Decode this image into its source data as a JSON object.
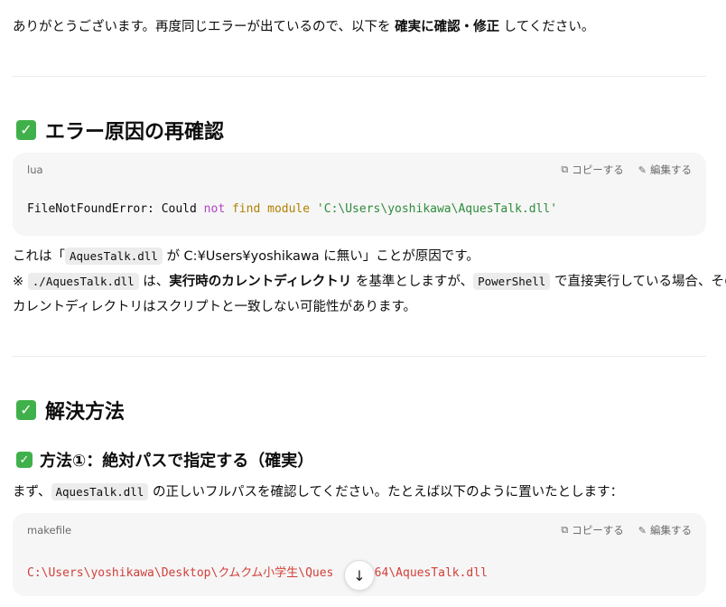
{
  "intro": {
    "pre": "ありがとうございます。再度同じエラーが出ているので、以下を ",
    "bold": "確実に確認・修正",
    "post": " してください。"
  },
  "section1": {
    "heading": "エラー原因の再確認",
    "code": {
      "lang": "lua",
      "copy_label": "コピーする",
      "edit_label": "編集する",
      "line": {
        "t1": "FileNotFoundError: Could ",
        "t2": "not",
        "t3": " ",
        "t4": "find",
        "t5": " ",
        "t6": "module",
        "t7": " ",
        "t8": "'C:\\Users\\yoshikawa\\AquesTalk.dll'"
      }
    },
    "para1": {
      "a": "これは「",
      "code1": "AquesTalk.dll",
      "b": " が C:¥Users¥yoshikawa に無い」ことが原因です。"
    },
    "para2": {
      "a": "※ ",
      "code1": "./AquesTalk.dll",
      "b": " は、",
      "bold": "実行時のカレントディレクトリ",
      "c": " を基準としますが、",
      "code2": "PowerShell",
      "d": " で直接実行している場合、その"
    },
    "para3": "カレントディレクトリはスクリプトと一致しない可能性があります。"
  },
  "section2": {
    "heading": "解決方法",
    "subheading": "方法①：絶対パスで指定する（確実）",
    "para": {
      "a": "まず、",
      "code1": "AquesTalk.dll",
      "b": " の正しいフルパスを確認してください。たとえば以下のように置いたとします："
    },
    "code": {
      "lang": "makefile",
      "copy_label": "コピーする",
      "edit_label": "編集する",
      "line": "C:\\Users\\yoshikawa\\Desktop\\クムクム小学生\\Ques",
      "line_tail": "\\bin64\\AquesTalk.dll"
    }
  },
  "icons": {
    "check": "check-box-icon",
    "copy": "copy-icon",
    "edit": "pencil-icon",
    "scroll": "arrow-down-icon"
  },
  "colors": {
    "check_green": "#40b14a",
    "keyword": "#b144c3",
    "function": "#b08000",
    "string": "#2e8b3b",
    "path_red": "#d2403a",
    "code_bg": "#f6f6f6"
  }
}
